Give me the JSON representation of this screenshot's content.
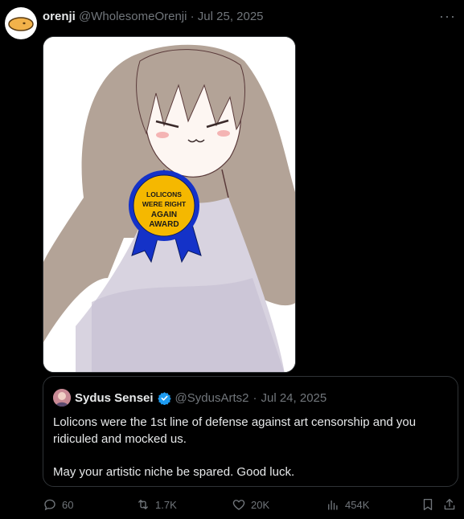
{
  "tweet": {
    "display_name": "orenji",
    "handle": "@WholesomeOrenji",
    "separator": "·",
    "date": "Jul 25, 2025",
    "more_label": "···"
  },
  "media": {
    "ribbon_text": [
      "LOLICONS",
      "WERE RIGHT",
      "AGAIN",
      "AWARD"
    ],
    "ribbon_colors": {
      "badge": "#f5b800",
      "ribbon": "#1432c8"
    }
  },
  "quote": {
    "display_name": "Sydus Sensei",
    "handle": "@SydusArts2",
    "separator": "·",
    "date": "Jul 24, 2025",
    "text_line1": "Lolicons were the 1st line of defense against art censorship and you ridiculed and mocked us.",
    "text_line2": "May your artistic niche be spared. Good luck."
  },
  "actions": {
    "replies": "60",
    "reposts": "1.7K",
    "likes": "20K",
    "views": "454K"
  },
  "colors": {
    "accent": "#1d9bf0",
    "muted": "#71767b",
    "border": "#2f3336"
  }
}
